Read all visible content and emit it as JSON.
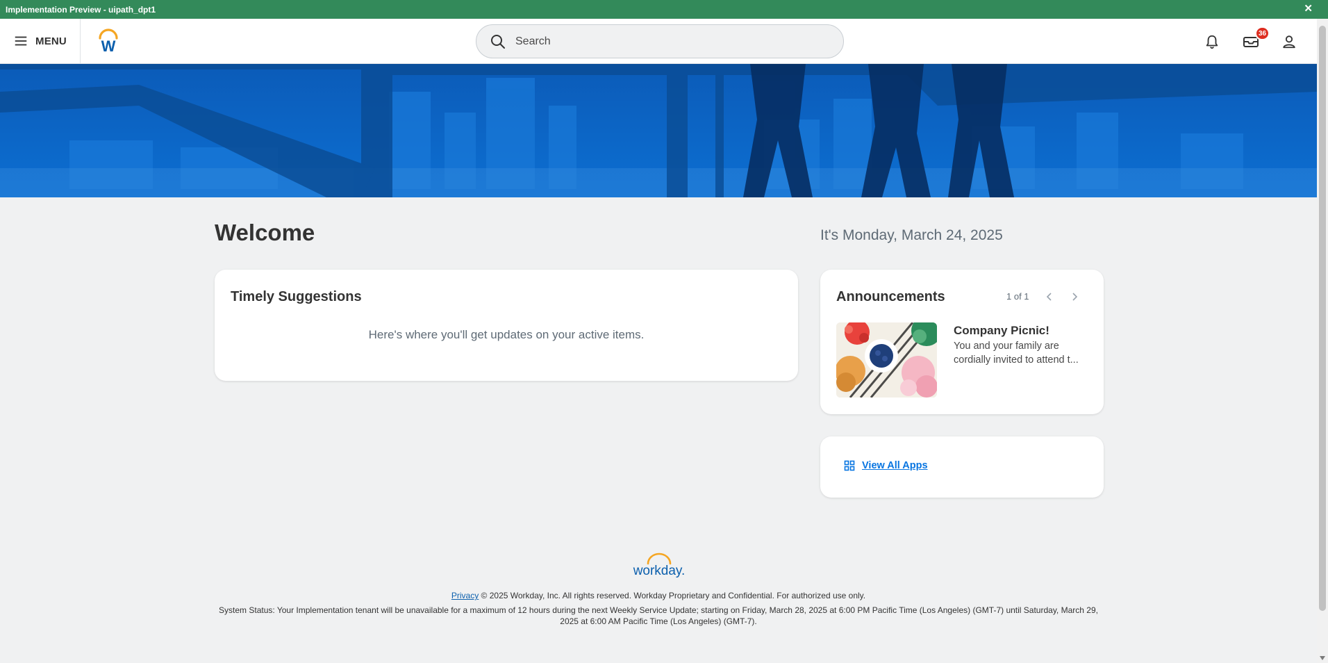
{
  "preview_bar": {
    "title": "Implementation Preview - uipath_dpt1",
    "close_glyph": "✕"
  },
  "header": {
    "menu_label": "MENU",
    "search_placeholder": "Search",
    "notifications_icon": "bell-icon",
    "inbox_icon": "inbox-icon",
    "inbox_badge": "36",
    "profile_icon": "user-icon"
  },
  "main": {
    "welcome": "Welcome",
    "date": "It's Monday, March 24, 2025",
    "timely": {
      "title": "Timely Suggestions",
      "message": "Here's where you'll get updates on your active items."
    },
    "announcements": {
      "title": "Announcements",
      "pager": "1 of 1",
      "item_title": "Company Picnic!",
      "item_desc": "You and your family are cordially invited to attend t..."
    },
    "apps": {
      "link": "View All Apps"
    }
  },
  "footer": {
    "privacy": "Privacy",
    "copyright": " © 2025 Workday, Inc. All rights reserved. Workday Proprietary and Confidential. For authorized use only.",
    "status": "System Status: Your Implementation tenant will be unavailable for a maximum of 12 hours during the next Weekly Service Update; starting on Friday, March 28, 2025 at 6:00 PM Pacific Time (Los Angeles) (GMT-7) until Saturday, March 29, 2025 at 6:00 AM Pacific Time (Los Angeles) (GMT-7).",
    "logo_text": "workday."
  },
  "colors": {
    "preview_bar": "#338a5a",
    "banner": "#0a62c4",
    "link": "#0875e1",
    "badge": "#de2e21"
  }
}
